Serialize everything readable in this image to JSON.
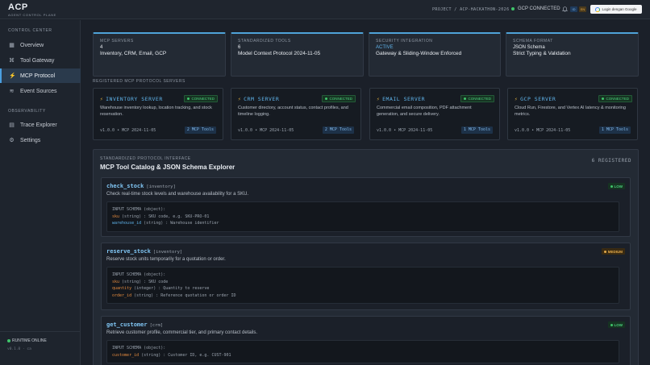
{
  "brand": {
    "name": "ACP",
    "subtitle": "AGENT CONTROL PLANE"
  },
  "header": {
    "breadcrumb": "PROJECT / ACP-HACKATHON-2026",
    "gcp_status": "GCP CONNECTED",
    "lang_id": "ID",
    "lang_en": "EN",
    "login_label": "Login dengan Google"
  },
  "sidebar": {
    "control_heading": "CONTROL CENTER",
    "items": [
      {
        "label": "Overview",
        "icon": "grid-icon"
      },
      {
        "label": "Tool Gateway",
        "icon": "command-icon"
      },
      {
        "label": "MCP Protocol",
        "icon": "bolt-icon"
      },
      {
        "label": "Event Sources",
        "icon": "waves-icon"
      }
    ],
    "observability_heading": "OBSERVABILITY",
    "obs_items": [
      {
        "label": "Trace Explorer",
        "icon": "trace-icon"
      },
      {
        "label": "Settings",
        "icon": "gear-icon"
      }
    ],
    "runtime": "RUNTIME ONLINE",
    "version": "v0.1.0 · ca"
  },
  "stats": [
    {
      "label": "MCP SERVERS",
      "value": "4",
      "desc": "Inventory, CRM, Email, GCP"
    },
    {
      "label": "STANDARDIZED TOOLS",
      "value": "6",
      "desc": "Model Context Protocol 2024-11-05"
    },
    {
      "label": "SECURITY INTEGRATION",
      "value": "ACTIVE",
      "desc": "Gateway & Sliding-Window Enforced"
    },
    {
      "label": "SCHEMA FORMAT",
      "value": "JSON Schema",
      "desc": "Strict Typing & Validation"
    }
  ],
  "servers_heading": "REGISTERED MCP PROTOCOL SERVERS",
  "servers": [
    {
      "name": "INVENTORY SERVER",
      "status": "CONNECTED",
      "desc": "Warehouse inventory lookup, location tracking, and stock reservation.",
      "version": "v1.0.0 • MCP 2024-11-05",
      "tools": "2 MCP Tools"
    },
    {
      "name": "CRM SERVER",
      "status": "CONNECTED",
      "desc": "Customer directory, account status, contact profiles, and timeline logging.",
      "version": "v1.0.0 • MCP 2024-11-05",
      "tools": "2 MCP Tools"
    },
    {
      "name": "EMAIL SERVER",
      "status": "CONNECTED",
      "desc": "Commercial email composition, PDF attachment generation, and secure delivery.",
      "version": "v1.0.0 • MCP 2024-11-05",
      "tools": "1 MCP Tools"
    },
    {
      "name": "GCP SERVER",
      "status": "CONNECTED",
      "desc": "Cloud Run, Firestore, and Vertex AI latency & monitoring metrics.",
      "version": "v1.0.0 • MCP 2024-11-05",
      "tools": "1 MCP Tools"
    }
  ],
  "catalog": {
    "label": "STANDARDIZED PROTOCOL INTERFACE",
    "title": "MCP Tool Catalog & JSON Schema Explorer",
    "count": "6 REGISTERED",
    "schema_header": "INPUT SCHEMA (object):",
    "tools": [
      {
        "name": "check_stock",
        "category": "[inventory]",
        "risk": "LOW",
        "desc": "Check real-time stock levels and warehouse availability for a SKU.",
        "params": [
          {
            "name": "sku",
            "type": "(string) : SKU code, e.g. SKU-PRO-01"
          },
          {
            "name": "warehouse_id",
            "type": "(string) : Warehouse identifier"
          }
        ]
      },
      {
        "name": "reserve_stock",
        "category": "[inventory]",
        "risk": "MEDIUM",
        "desc": "Reserve stock units temporarily for a quotation or order.",
        "params": [
          {
            "name": "sku",
            "type": "(string) : SKU code"
          },
          {
            "name": "quantity",
            "type": "(integer) : Quantity to reserve"
          },
          {
            "name": "order_id",
            "type": "(string) : Reference quotation or order ID"
          }
        ]
      },
      {
        "name": "get_customer",
        "category": "[crm]",
        "risk": "LOW",
        "desc": "Retrieve customer profile, commercial tier, and primary contact details.",
        "params": [
          {
            "name": "customer_id",
            "type": "(string) : Customer ID, e.g. CUST-901"
          }
        ]
      }
    ]
  },
  "colors": {
    "accent": "#5fb3ea",
    "connected": "#4cd07d",
    "warning": "#e3a94a",
    "bg": "#1b2029"
  }
}
